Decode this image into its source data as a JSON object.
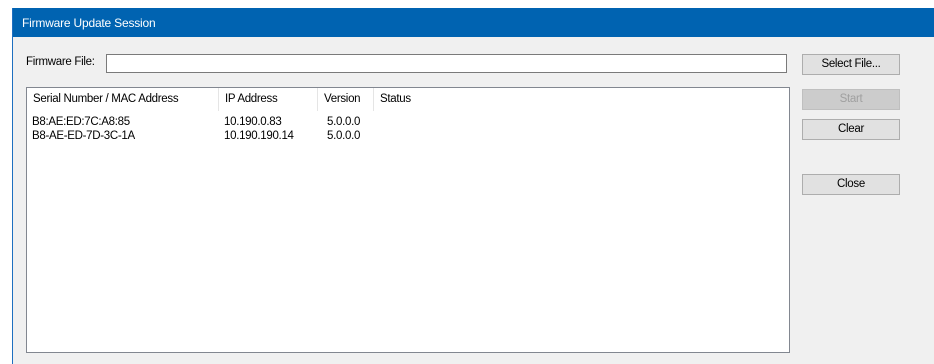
{
  "window": {
    "title": "Firmware Update Session"
  },
  "firmware_file": {
    "label": "Firmware File:",
    "value": ""
  },
  "buttons": {
    "select_file": "Select File...",
    "start": "Start",
    "clear": "Clear",
    "close": "Close"
  },
  "device_list": {
    "columns": [
      "Serial Number / MAC Address",
      "IP Address",
      "Version",
      "Status"
    ],
    "rows": [
      {
        "serial": "B8:AE:ED:7C:A8:85",
        "ip": "10.190.0.83",
        "version": "5.0.0.0",
        "status": ""
      },
      {
        "serial": "B8-AE-ED-7D-3C-1A",
        "ip": "10.190.190.14",
        "version": "5.0.0.0",
        "status": ""
      }
    ]
  },
  "colors": {
    "titlebar": "#0063b1",
    "window_bg": "#f0f0f0",
    "button_bg": "#e1e1e1",
    "disabled_text": "#a0a0a0"
  }
}
